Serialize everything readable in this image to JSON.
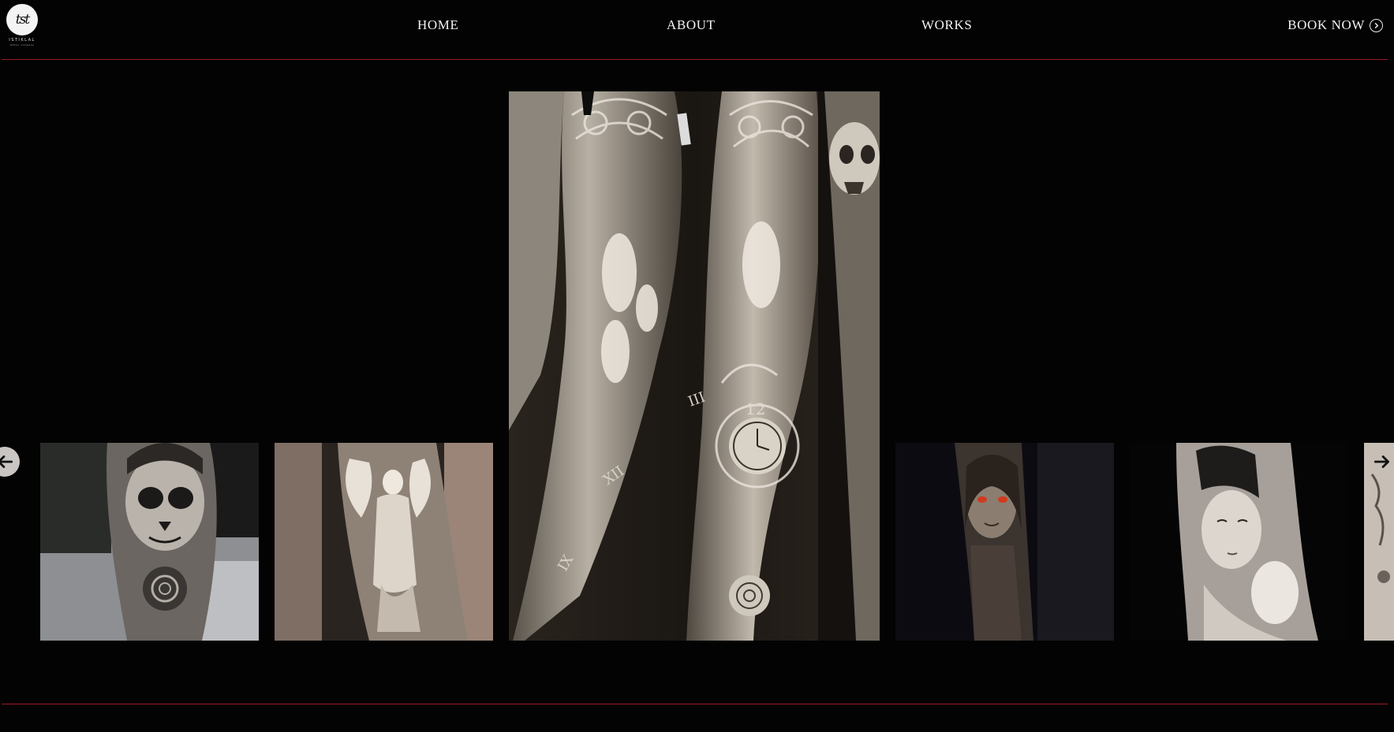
{
  "brand": {
    "logo_letters": "tst",
    "wordmark": "ISTIKLAL",
    "tagline": "tattoo company"
  },
  "nav": {
    "home": "HOME",
    "about": "ABOUT",
    "works": "WORKS",
    "book_now": "BOOK NOW"
  },
  "colors": {
    "background": "#030303",
    "divider": "#9b1c22",
    "text": "#f2f2f2"
  },
  "gallery": {
    "featured": {
      "subject": "Full-sleeve arm tattoos: stained-glass windows, angels, statues, clock and rose; skull on side"
    },
    "clock_numerals": [
      "12",
      "XII",
      "IX",
      "III"
    ],
    "thumbnails": [
      {
        "subject": "Sugar-skull woman portrait forearm tattoo with rose"
      },
      {
        "subject": "Angel statue forearm tattoo"
      },
      {
        "subject": "Dark-elf warrior portrait forearm tattoo"
      },
      {
        "subject": "Geisha portrait tattoo"
      },
      {
        "subject": "Partially visible tattoo"
      }
    ],
    "prev_icon": "arrow-left-icon",
    "next_icon": "arrow-right-icon"
  }
}
